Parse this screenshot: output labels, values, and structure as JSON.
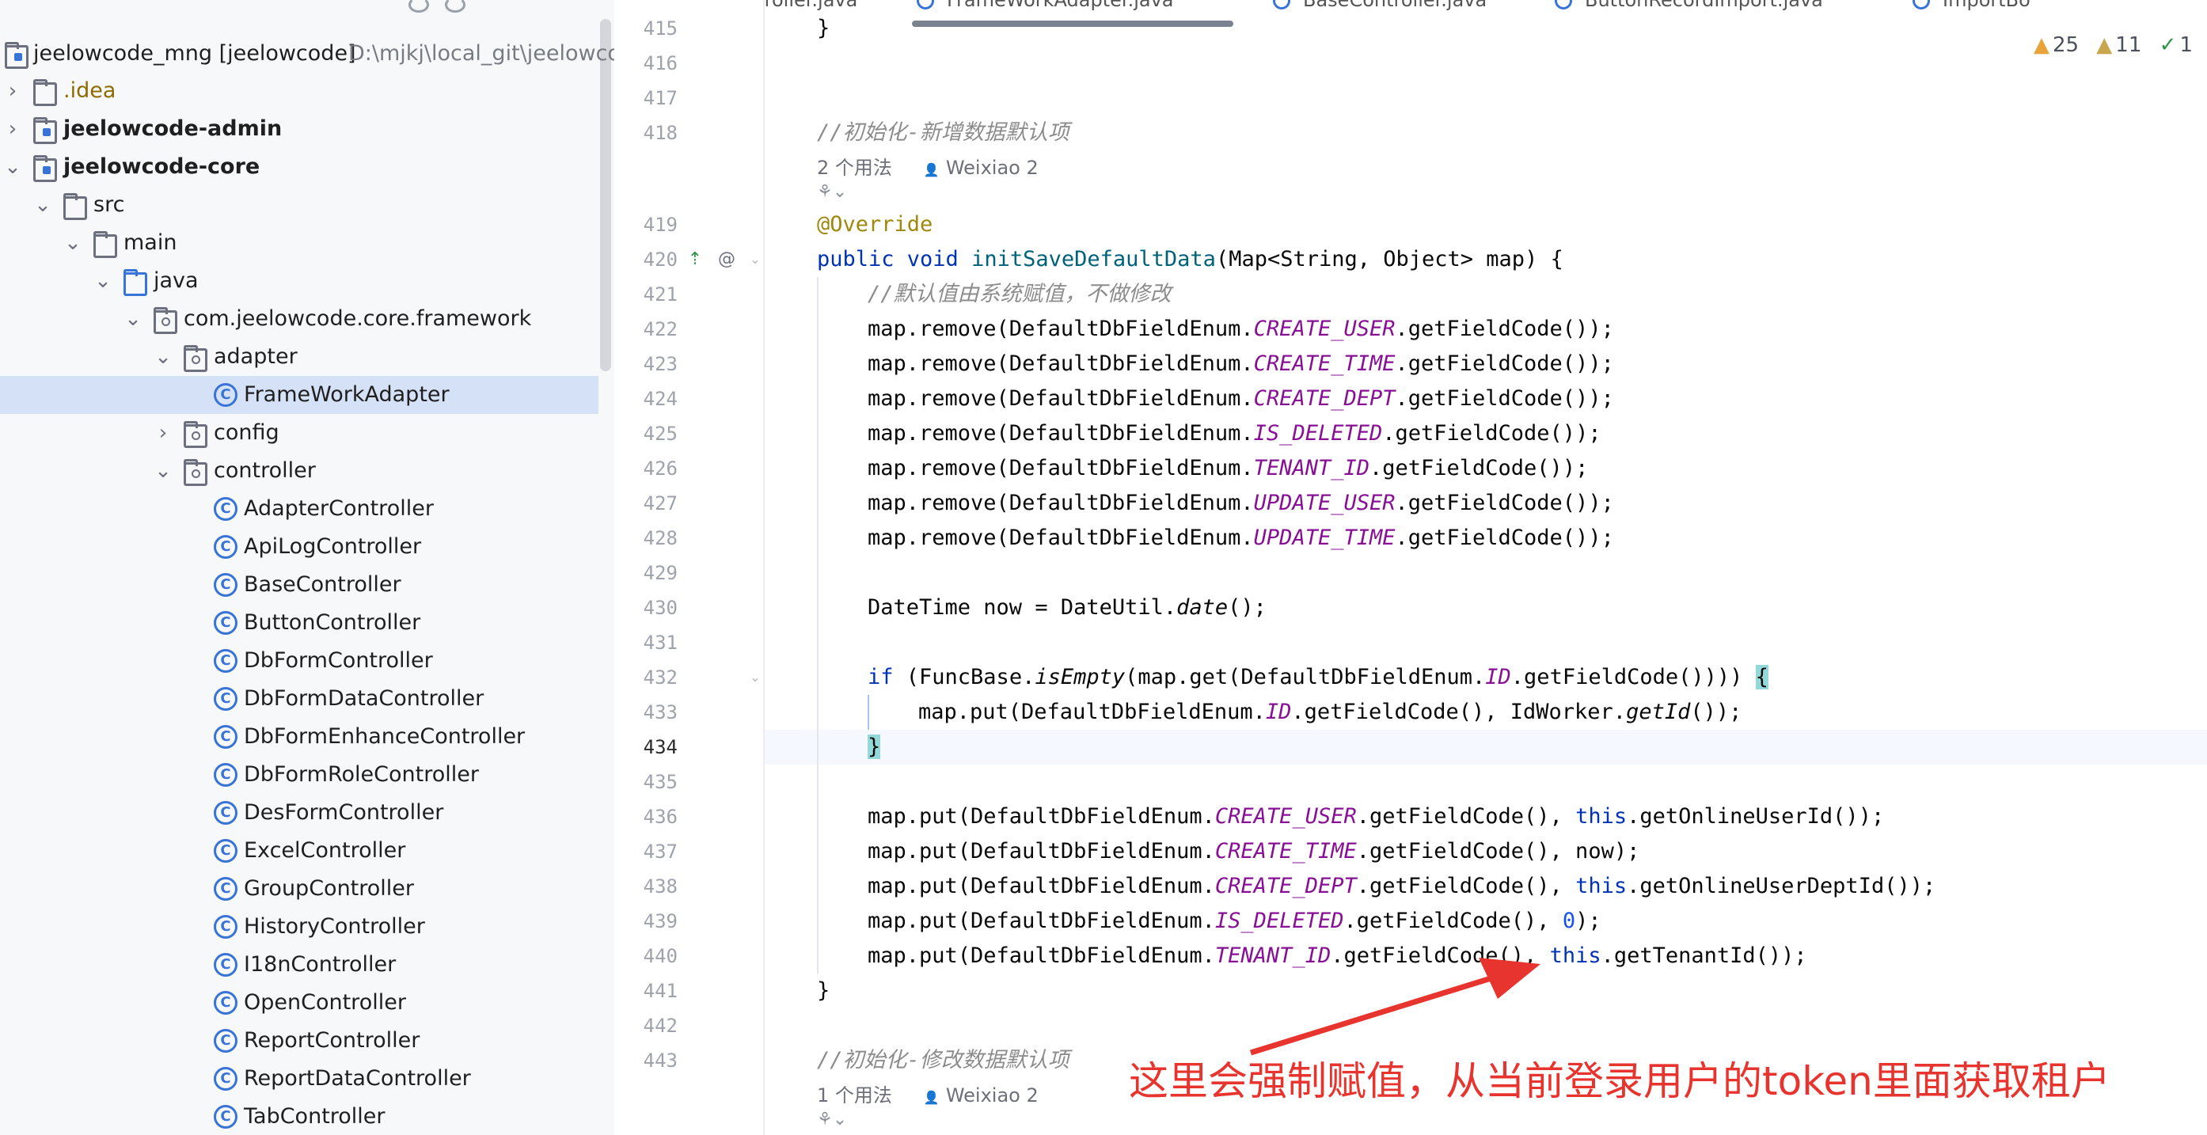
{
  "project_tree": {
    "root": {
      "name": "jeelowcode_mng [jeelowcode]",
      "path": "D:\\mjkj\\local_git\\jeelowcode"
    },
    "items": [
      {
        "label": ".idea"
      },
      {
        "label": "jeelowcode-admin"
      },
      {
        "label": "jeelowcode-core"
      },
      {
        "label": "src"
      },
      {
        "label": "main"
      },
      {
        "label": "java"
      },
      {
        "label": "com.jeelowcode.core.framework"
      },
      {
        "label": "adapter"
      },
      {
        "label": "FrameWorkAdapter"
      },
      {
        "label": "config"
      },
      {
        "label": "controller"
      },
      {
        "label": "AdapterController"
      },
      {
        "label": "ApiLogController"
      },
      {
        "label": "BaseController"
      },
      {
        "label": "ButtonController"
      },
      {
        "label": "DbFormController"
      },
      {
        "label": "DbFormDataController"
      },
      {
        "label": "DbFormEnhanceController"
      },
      {
        "label": "DbFormRoleController"
      },
      {
        "label": "DesFormController"
      },
      {
        "label": "ExcelController"
      },
      {
        "label": "GroupController"
      },
      {
        "label": "HistoryController"
      },
      {
        "label": "I18nController"
      },
      {
        "label": "OpenController"
      },
      {
        "label": "ReportController"
      },
      {
        "label": "ReportDataController"
      },
      {
        "label": "TabController"
      }
    ]
  },
  "tabs": [
    {
      "label": "ExcelController.java"
    },
    {
      "label": "FrameWorkAdapter.java"
    },
    {
      "label": "BaseController.java"
    },
    {
      "label": "ButtonRecordImport.java"
    },
    {
      "label": "ImportBo"
    }
  ],
  "inspections": {
    "errors": "25",
    "warnings": "11",
    "ok": "1"
  },
  "editor": {
    "line_numbers": [
      "415",
      "416",
      "417",
      "418",
      "419",
      "420",
      "421",
      "422",
      "423",
      "424",
      "425",
      "426",
      "427",
      "428",
      "429",
      "430",
      "431",
      "432",
      "433",
      "434",
      "435",
      "436",
      "437",
      "438",
      "439",
      "440",
      "441",
      "442",
      "443"
    ],
    "current_line": "434",
    "comment_init_save": "//初始化-新增数据默认项",
    "usages_1": "2 个用法",
    "author_1": "Weixiao 2",
    "override": "@Override",
    "comment_default": "//默认值由系统赋值，不做修改",
    "comment_init_update": "//初始化-修改数据默认项",
    "usages_2": "1 个用法",
    "author_2": "Weixiao 2",
    "close_brace_415": "}",
    "close_brace_441": "}"
  },
  "annotation": {
    "note": "这里会强制赋值，从当前登录用户的token里面获取租户",
    "color": "#e8342e"
  }
}
